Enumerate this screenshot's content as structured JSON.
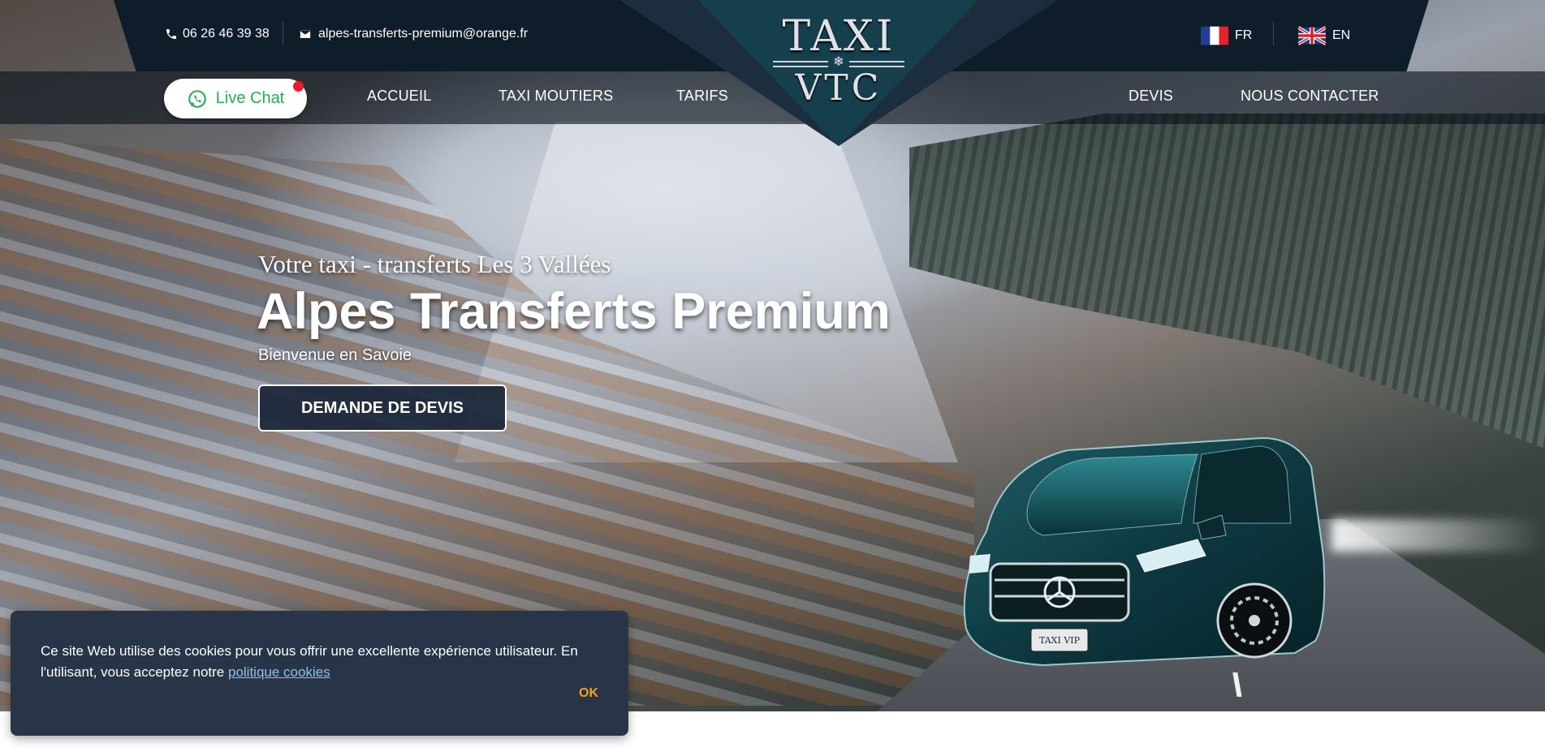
{
  "header": {
    "phone": "06 26 46 39 38",
    "email": "alpes-transferts-premium@orange.fr",
    "logo": {
      "line1": "TAXI",
      "line2": "VTC"
    },
    "languages": [
      {
        "code": "FR",
        "flag": "france-flag"
      },
      {
        "code": "EN",
        "flag": "uk-flag"
      }
    ]
  },
  "nav": {
    "live_chat": "Live Chat",
    "items": [
      "ACCUEIL",
      "TAXI MOUTIERS",
      "TARIFS",
      "DEVIS",
      "NOUS CONTACTER"
    ]
  },
  "hero": {
    "subtitle": "Votre taxi - transferts Les 3 Vallées",
    "title": "Alpes Transferts Premium",
    "welcome": "Bienvenue en Savoie",
    "cta": "DEMANDE DE DEVIS",
    "van_plate": "TAXI VIP"
  },
  "cookie": {
    "text": "Ce site Web utilise des cookies pour vous offrir une excellente expérience utilisateur. En l'utilisant, vous acceptez notre",
    "link": "politique cookies",
    "ok": "OK"
  },
  "colors": {
    "topbar": "#0f1d2a",
    "whatsapp_green": "#25b04f",
    "cta_bg": "#192538",
    "cookie_bg": "#283447",
    "cookie_ok": "#f0a51e",
    "link": "#89c4e8"
  }
}
